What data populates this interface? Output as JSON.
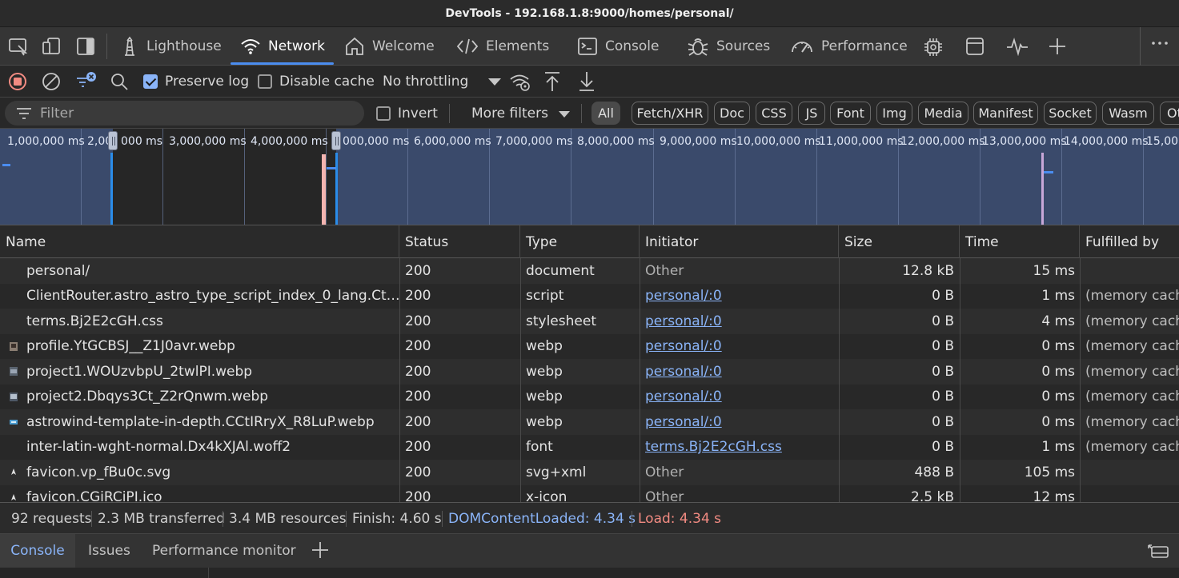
{
  "window_title": "DevTools - 192.168.1.8:9000/homes/personal/",
  "tabs": [
    {
      "label": "Lighthouse",
      "icon": "lighthouse-icon"
    },
    {
      "label": "Network",
      "icon": "wifi-icon",
      "active": true
    },
    {
      "label": "Welcome",
      "icon": "house-icon"
    },
    {
      "label": "Elements",
      "icon": "code-icon"
    },
    {
      "label": "Console",
      "icon": "terminal-icon"
    },
    {
      "label": "Sources",
      "icon": "bug-icon"
    },
    {
      "label": "Performance",
      "icon": "gauge-icon"
    }
  ],
  "toolbar": {
    "preserve_log": "Preserve log",
    "preserve_log_checked": true,
    "disable_cache": "Disable cache",
    "disable_cache_checked": false,
    "throttling": "No throttling"
  },
  "filter": {
    "placeholder": "Filter",
    "invert": "Invert",
    "more_filters": "More filters",
    "types": [
      "All",
      "Fetch/XHR",
      "Doc",
      "CSS",
      "JS",
      "Font",
      "Img",
      "Media",
      "Manifest",
      "Socket",
      "Wasm",
      "Ot"
    ]
  },
  "overview": {
    "ticks": [
      "1,000,000 ms",
      "2,00",
      "000 ms",
      "3,000,000 ms",
      "4,000,000 ms",
      "000,000 ms",
      "6,000,000 ms",
      "7,000,000 ms",
      "8,000,000 ms",
      "9,000,000 ms",
      "10,000,000 ms",
      "11,000,000 ms",
      "12,000,000 ms",
      "13,000,000 ms",
      "14,000,000 ms",
      "15,000"
    ]
  },
  "table": {
    "headers": {
      "name": "Name",
      "status": "Status",
      "type": "Type",
      "initiator": "Initiator",
      "size": "Size",
      "time": "Time",
      "fulfilled": "Fulfilled by"
    },
    "rows": [
      {
        "name": "personal/",
        "status": "200",
        "type": "document",
        "initiator": "Other",
        "initiator_link": false,
        "size": "12.8 kB",
        "time": "15 ms",
        "fulfilled": ""
      },
      {
        "name": "ClientRouter.astro_astro_type_script_index_0_lang.Ct…",
        "status": "200",
        "type": "script",
        "initiator": "personal/:0",
        "initiator_link": true,
        "size": "0 B",
        "time": "1 ms",
        "fulfilled": "(memory cache)"
      },
      {
        "name": "terms.Bj2E2cGH.css",
        "status": "200",
        "type": "stylesheet",
        "initiator": "personal/:0",
        "initiator_link": true,
        "size": "0 B",
        "time": "4 ms",
        "fulfilled": "(memory cache)"
      },
      {
        "name": "profile.YtGCBSJ__Z1J0avr.webp",
        "status": "200",
        "type": "webp",
        "initiator": "personal/:0",
        "initiator_link": true,
        "size": "0 B",
        "time": "0 ms",
        "fulfilled": "(memory cache)"
      },
      {
        "name": "project1.WOUzvbpU_2twlPI.webp",
        "status": "200",
        "type": "webp",
        "initiator": "personal/:0",
        "initiator_link": true,
        "size": "0 B",
        "time": "0 ms",
        "fulfilled": "(memory cache)"
      },
      {
        "name": "project2.Dbqys3Ct_Z2rQnwm.webp",
        "status": "200",
        "type": "webp",
        "initiator": "personal/:0",
        "initiator_link": true,
        "size": "0 B",
        "time": "0 ms",
        "fulfilled": "(memory cache)"
      },
      {
        "name": "astrowind-template-in-depth.CCtIRryX_R8LuP.webp",
        "status": "200",
        "type": "webp",
        "initiator": "personal/:0",
        "initiator_link": true,
        "size": "0 B",
        "time": "0 ms",
        "fulfilled": "(memory cache)"
      },
      {
        "name": "inter-latin-wght-normal.Dx4kXJAl.woff2",
        "status": "200",
        "type": "font",
        "initiator": "terms.Bj2E2cGH.css",
        "initiator_link": true,
        "size": "0 B",
        "time": "1 ms",
        "fulfilled": "(memory cache)"
      },
      {
        "name": "favicon.vp_fBu0c.svg",
        "status": "200",
        "type": "svg+xml",
        "initiator": "Other",
        "initiator_link": false,
        "size": "488 B",
        "time": "105 ms",
        "fulfilled": ""
      },
      {
        "name": "favicon.CGiRCiPI.ico",
        "status": "200",
        "type": "x-icon",
        "initiator": "Other",
        "initiator_link": false,
        "size": "2.5 kB",
        "time": "12 ms",
        "fulfilled": ""
      }
    ]
  },
  "summary": {
    "requests": "92 requests",
    "transferred": "2.3 MB transferred",
    "resources": "3.4 MB resources",
    "finish": "Finish: 4.60 s",
    "dcl": "DOMContentLoaded: 4.34 s",
    "load": "Load: 4.34 s",
    "dcl_color": "#8ab4f8",
    "load_color": "#f28b82"
  },
  "drawer": {
    "tabs": [
      "Console",
      "Issues",
      "Performance monitor"
    ]
  }
}
